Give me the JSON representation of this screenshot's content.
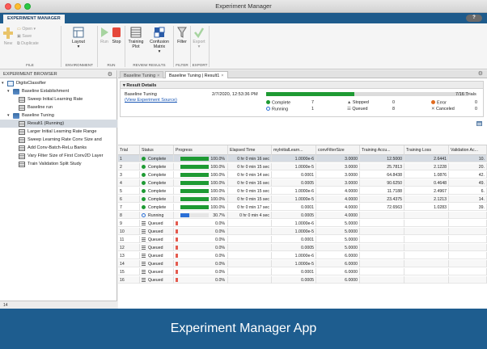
{
  "window": {
    "title": "Experiment Manager"
  },
  "tab": {
    "label": "EXPERIMENT MANAGER",
    "help": "?"
  },
  "toolstrip": {
    "new": "New",
    "open": "Open",
    "save": "Save",
    "duplicate": "Duplicate",
    "layout": "Layout",
    "run": "Run",
    "stop": "Stop",
    "training_plot": "Training Plot",
    "confusion_matrix": "Confusion Matrix",
    "filter": "Filter",
    "export": "Export",
    "sections": {
      "file": "FILE",
      "environment": "ENVIRONMENT",
      "run": "RUN",
      "review": "REVIEW RESULTS",
      "filter": "FILTER",
      "export": "EXPORT"
    }
  },
  "browser": {
    "title": "EXPERIMENT BROWSER",
    "items": [
      {
        "label": "DigitsClassifier",
        "level": 0
      },
      {
        "label": "Baseline Establishment",
        "level": 1
      },
      {
        "label": "Sweep Initial Learning Rate",
        "level": 2
      },
      {
        "label": "Baseline run",
        "level": 2
      },
      {
        "label": "Baseline Tuning",
        "level": 1
      },
      {
        "label": "Result1 (Running)",
        "level": 2
      },
      {
        "label": "Larger Initial Learning Rate Range",
        "level": 2
      },
      {
        "label": "Sweep Learning Rate Conv Size and",
        "level": 2
      },
      {
        "label": "Add Conv-Batch-ReLu Banks",
        "level": 2
      },
      {
        "label": "Vary Filter Size of First Conv2D Layer",
        "level": 2
      },
      {
        "label": "Train Validation Split Study",
        "level": 2
      }
    ],
    "status": "14"
  },
  "doctabs": {
    "tab1": "Baseline Tuning",
    "tab2": "Baseline Tuning | Result1"
  },
  "details": {
    "header": "Result Details",
    "name": "Baseline Tuning",
    "link": "(View Experiment Source)",
    "date": "2/7/2020, 12:53:36 PM",
    "trials_label": "7/16 Trials",
    "progress": 0.4375,
    "complete_label": "Complete",
    "complete": "7",
    "running_label": "Running",
    "running": "1",
    "stopped_label": "Stopped",
    "stopped": "0",
    "queued_label": "Queued",
    "queued": "8",
    "error_label": "Error",
    "error": "0",
    "canceled_label": "Canceled",
    "canceled": "0"
  },
  "table": {
    "headers": [
      "Trial",
      "Status",
      "Progress",
      "Elapsed Time",
      "myInitialLearn...",
      "convFilterSize",
      "Training Accu...",
      "Training Loss",
      "Validation Ac..."
    ],
    "rows": [
      {
        "trial": "1",
        "status": "Complete",
        "progress": 1.0,
        "pct": "100.0%",
        "time": "0 hr 0 min 16 sec",
        "lr": "1.0000e-6",
        "cfs": "3.0000",
        "tacc": "12.5000",
        "tloss": "2.6441",
        "vacc": "10."
      },
      {
        "trial": "2",
        "status": "Complete",
        "progress": 1.0,
        "pct": "100.0%",
        "time": "0 hr 0 min 15 sec",
        "lr": "1.0000e-5",
        "cfs": "3.0000",
        "tacc": "25.7813",
        "tloss": "2.1228",
        "vacc": "20."
      },
      {
        "trial": "3",
        "status": "Complete",
        "progress": 1.0,
        "pct": "100.0%",
        "time": "0 hr 0 min 14 sec",
        "lr": "0.0001",
        "cfs": "3.0000",
        "tacc": "64.8438",
        "tloss": "1.0876",
        "vacc": "42."
      },
      {
        "trial": "4",
        "status": "Complete",
        "progress": 1.0,
        "pct": "100.0%",
        "time": "0 hr 0 min 16 sec",
        "lr": "0.0005",
        "cfs": "3.0000",
        "tacc": "90.6250",
        "tloss": "0.4648",
        "vacc": "49."
      },
      {
        "trial": "5",
        "status": "Complete",
        "progress": 1.0,
        "pct": "100.0%",
        "time": "0 hr 0 min 15 sec",
        "lr": "1.0000e-6",
        "cfs": "4.0000",
        "tacc": "11.7188",
        "tloss": "2.4967",
        "vacc": "6."
      },
      {
        "trial": "6",
        "status": "Complete",
        "progress": 1.0,
        "pct": "100.0%",
        "time": "0 hr 0 min 15 sec",
        "lr": "1.0000e-5",
        "cfs": "4.0000",
        "tacc": "23.4375",
        "tloss": "2.1213",
        "vacc": "14."
      },
      {
        "trial": "7",
        "status": "Complete",
        "progress": 1.0,
        "pct": "100.0%",
        "time": "0 hr 0 min 17 sec",
        "lr": "0.0001",
        "cfs": "4.0000",
        "tacc": "72.6563",
        "tloss": "1.0283",
        "vacc": "39."
      },
      {
        "trial": "8",
        "status": "Running",
        "progress": 0.307,
        "pct": "30.7%",
        "time": "0 hr 0 min 4 sec",
        "lr": "0.0005",
        "cfs": "4.0000",
        "tacc": "",
        "tloss": "",
        "vacc": ""
      },
      {
        "trial": "9",
        "status": "Queued",
        "progress": 0,
        "pct": "0.0%",
        "time": "",
        "lr": "1.0000e-6",
        "cfs": "5.0000",
        "tacc": "",
        "tloss": "",
        "vacc": ""
      },
      {
        "trial": "10",
        "status": "Queued",
        "progress": 0,
        "pct": "0.0%",
        "time": "",
        "lr": "1.0000e-5",
        "cfs": "5.0000",
        "tacc": "",
        "tloss": "",
        "vacc": ""
      },
      {
        "trial": "11",
        "status": "Queued",
        "progress": 0,
        "pct": "0.0%",
        "time": "",
        "lr": "0.0001",
        "cfs": "5.0000",
        "tacc": "",
        "tloss": "",
        "vacc": ""
      },
      {
        "trial": "12",
        "status": "Queued",
        "progress": 0,
        "pct": "0.0%",
        "time": "",
        "lr": "0.0005",
        "cfs": "5.0000",
        "tacc": "",
        "tloss": "",
        "vacc": ""
      },
      {
        "trial": "13",
        "status": "Queued",
        "progress": 0,
        "pct": "0.0%",
        "time": "",
        "lr": "1.0000e-6",
        "cfs": "6.0000",
        "tacc": "",
        "tloss": "",
        "vacc": ""
      },
      {
        "trial": "14",
        "status": "Queued",
        "progress": 0,
        "pct": "0.0%",
        "time": "",
        "lr": "1.0000e-5",
        "cfs": "6.0000",
        "tacc": "",
        "tloss": "",
        "vacc": ""
      },
      {
        "trial": "15",
        "status": "Queued",
        "progress": 0,
        "pct": "0.0%",
        "time": "",
        "lr": "0.0001",
        "cfs": "6.0000",
        "tacc": "",
        "tloss": "",
        "vacc": ""
      },
      {
        "trial": "16",
        "status": "Queued",
        "progress": 0,
        "pct": "0.0%",
        "time": "",
        "lr": "0.0005",
        "cfs": "6.0000",
        "tacc": "",
        "tloss": "",
        "vacc": ""
      }
    ]
  },
  "colors": {
    "complete": "#1e9a33",
    "running": "#2b6fd6",
    "queued": "#e45b4f",
    "accent": "#1e5d8f"
  },
  "banner": {
    "text": "Experiment Manager App"
  }
}
